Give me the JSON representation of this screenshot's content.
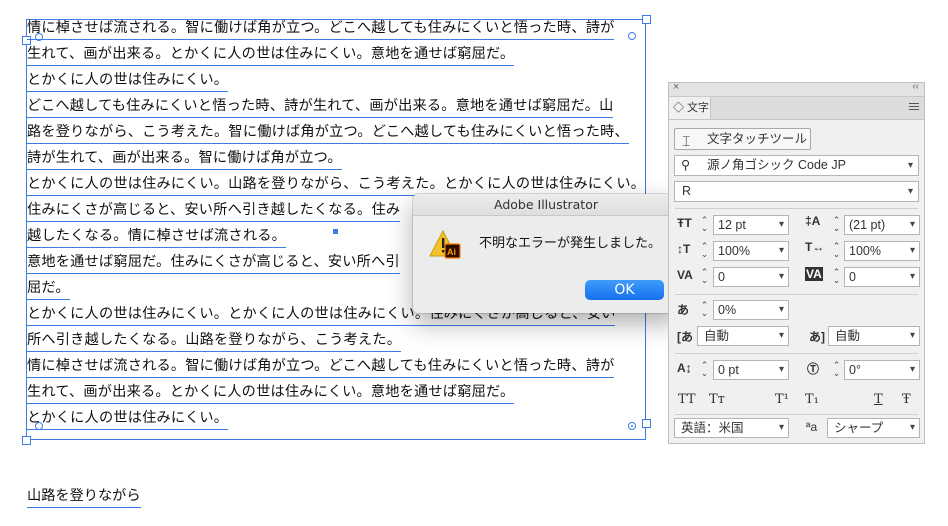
{
  "canvas": {
    "lines": [
      "情に棹させば流される。智に働けば角が立つ。どこへ越しても住みにくいと悟った時、詩が",
      "生れて、画が出来る。とかくに人の世は住みにくい。意地を通せば窮屈だ。",
      "とかくに人の世は住みにくい。",
      "どこへ越しても住みにくいと悟った時、詩が生れて、画が出来る。意地を通せば窮屈だ。山",
      "路を登りながら、こう考えた。智に働けば角が立つ。どこへ越しても住みにくいと悟った時、",
      "詩が生れて、画が出来る。智に働けば角が立つ。",
      "とかくに人の世は住みにくい。山路を登りながら、こう考えた。とかくに人の世は住みにくい。",
      "住みにくさが高じると、安い所へ引き越したくなる。住み",
      "越したくなる。情に棹させば流される。",
      "意地を通せば窮屈だ。住みにくさが高じると、安い所へ引",
      "屈だ。",
      "とかくに人の世は住みにくい。とかくに人の世は住みにくい。住みにくさが高じると、安い",
      "所へ引き越したくなる。山路を登りながら、こう考えた。",
      "情に棹させば流される。智に働けば角が立つ。どこへ越しても住みにくいと悟った時、詩が",
      "生れて、画が出来る。とかくに人の世は住みにくい。意地を通せば窮屈だ。",
      "とかくに人の世は住みにくい。"
    ],
    "extra_line": "山路を登りながら"
  },
  "dialog": {
    "title": "Adobe Illustrator",
    "message": "不明なエラーが発生しました。",
    "ok_label": "OK",
    "icon": "warning-illustrator-icon"
  },
  "panel": {
    "close_glyph": "×",
    "collapse_glyph": "‹‹",
    "tab_label": "◇ 文字",
    "touch_tool_label": "文字タッチツール",
    "font_family": "源ノ角ゴシック Code JP",
    "font_style": "R",
    "font_size": "12 pt",
    "leading": "(21 pt)",
    "vertical_scale": "100%",
    "horizontal_scale": "100%",
    "kerning": "0",
    "tracking": "0",
    "tsume": "0%",
    "aki_left": "自動",
    "aki_right": "自動",
    "baseline_shift": "0 pt",
    "rotation": "0°",
    "style_buttons": [
      "TT",
      "Tт",
      "T¹",
      "T₁",
      "T",
      "Ŧ"
    ],
    "language": "英語：米国",
    "antialias_prefix": "ªa",
    "antialias": "シャープ"
  },
  "colors": {
    "selection": "#3d7be6",
    "ok_button": "#1f7df4",
    "panel_bg": "#f0f0f0"
  }
}
